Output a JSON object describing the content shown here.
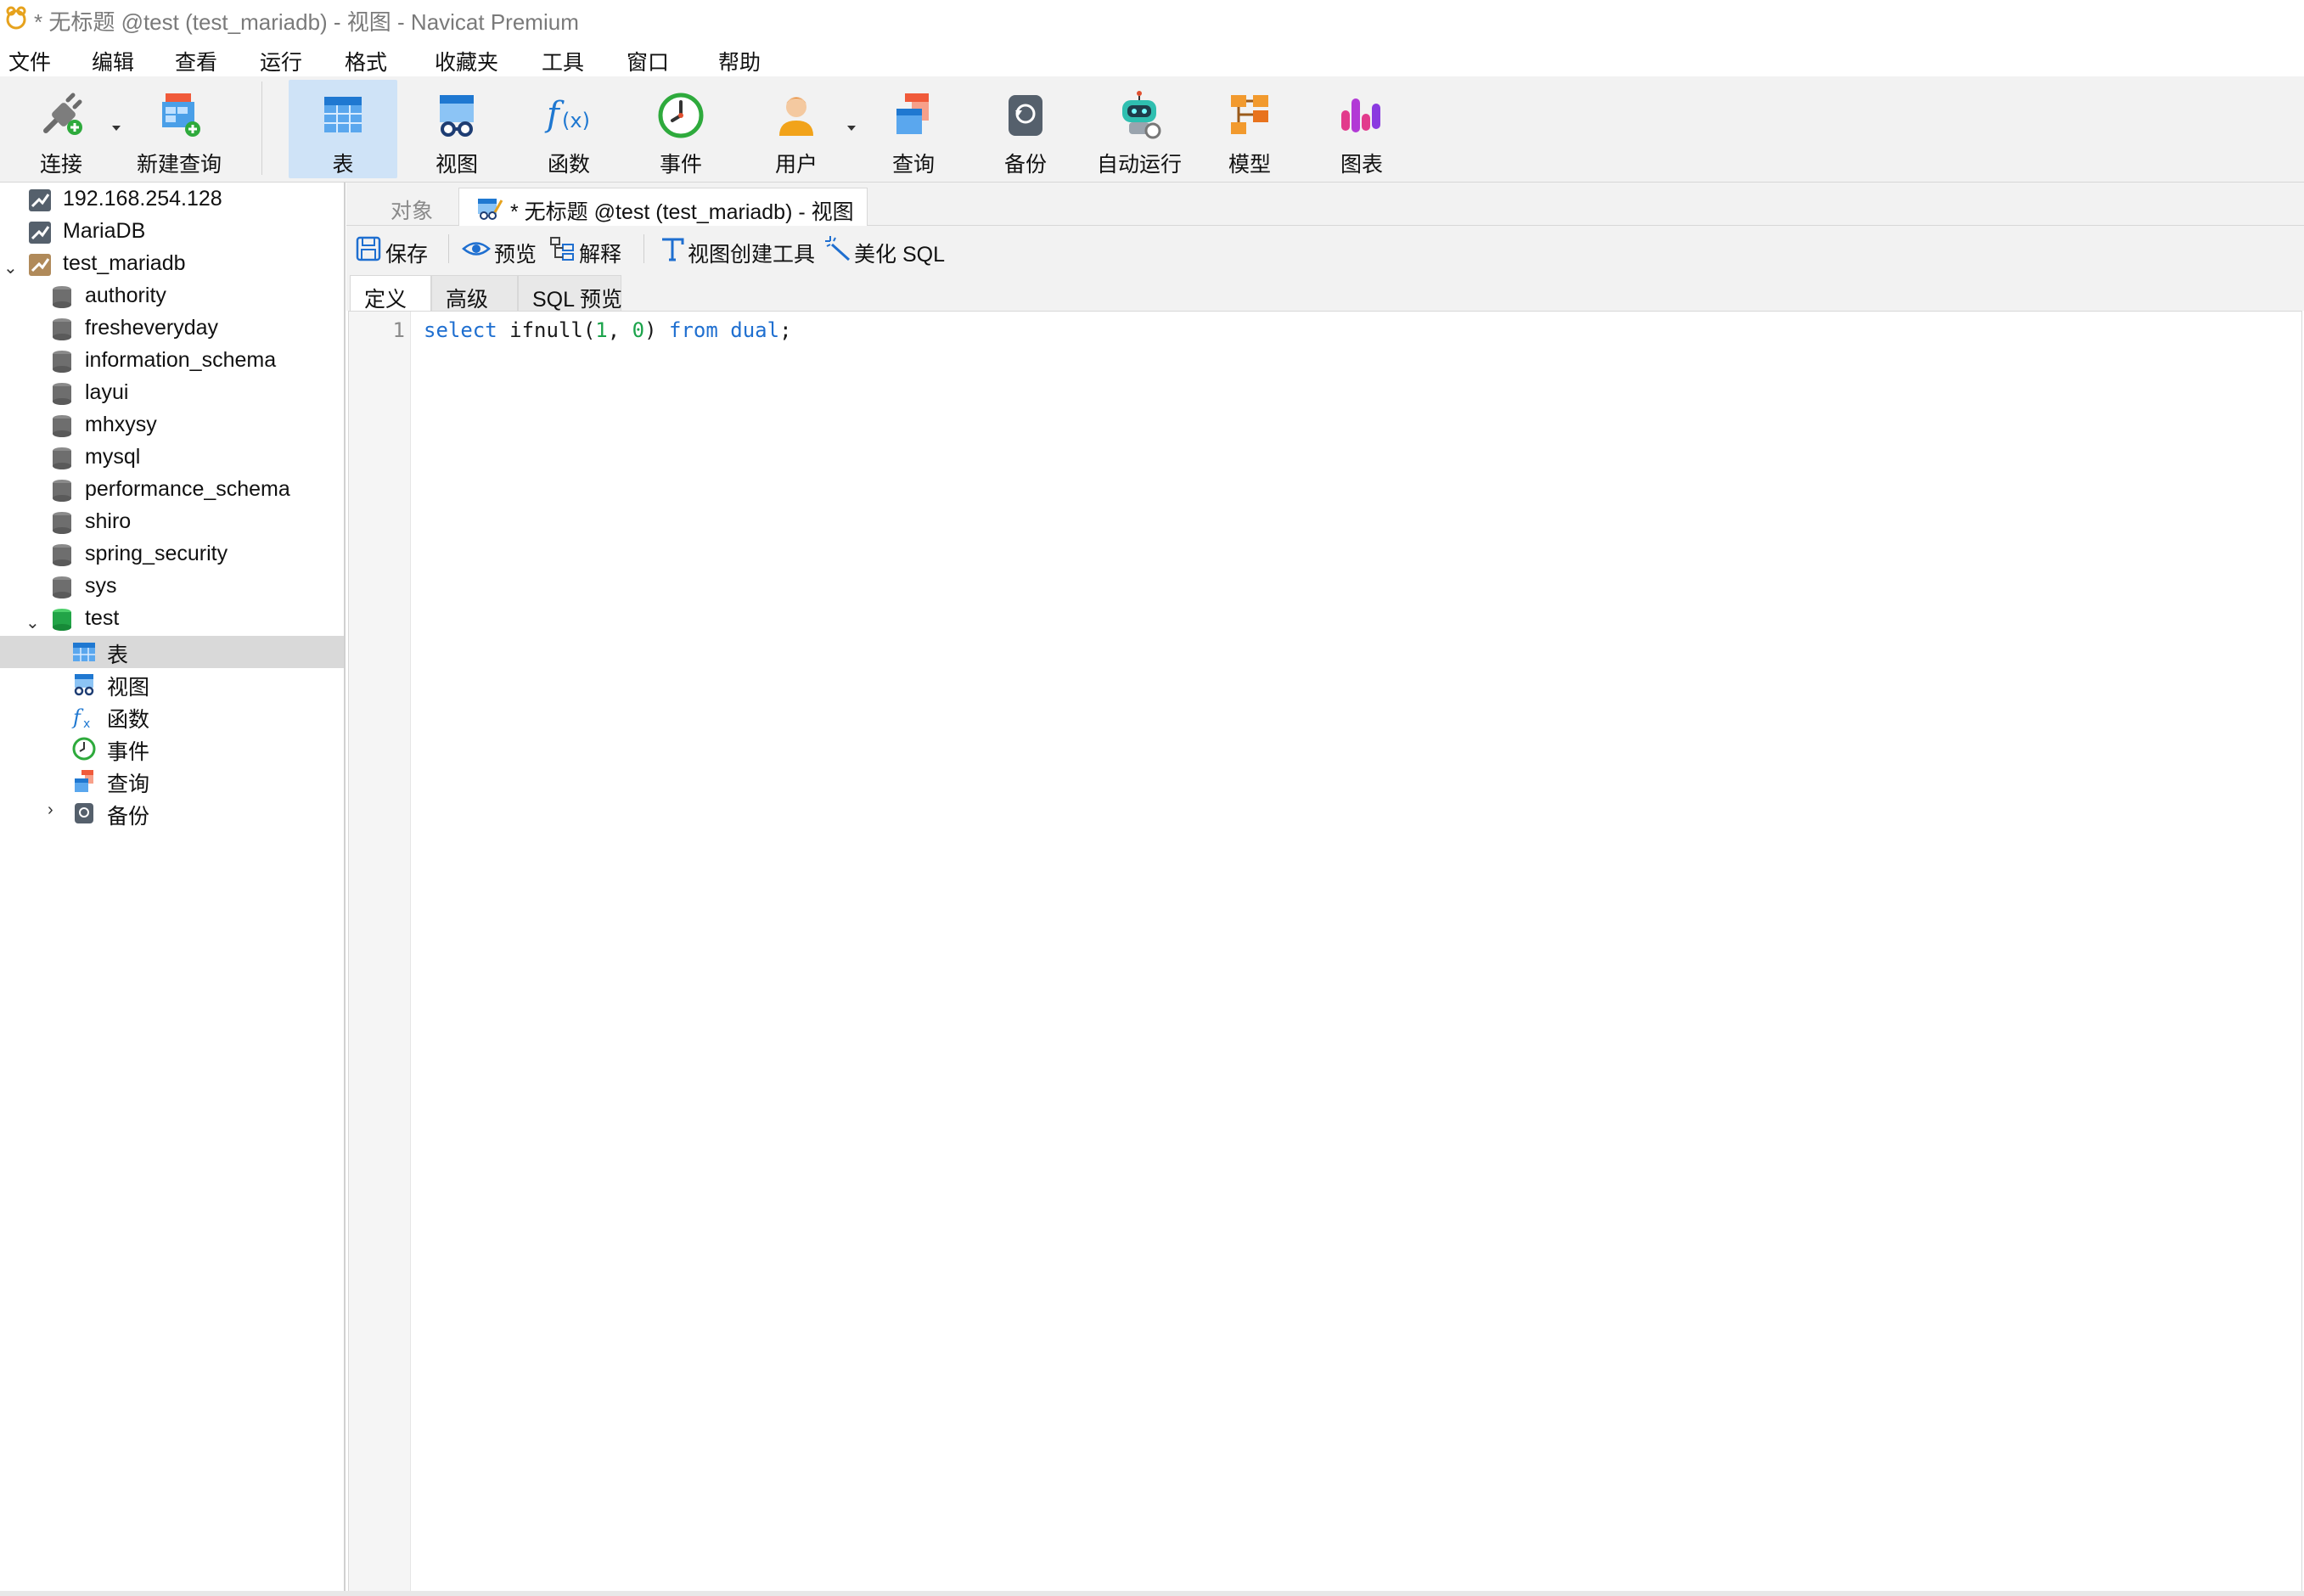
{
  "window": {
    "title": "* 无标题 @test (test_mariadb) - 视图 - Navicat Premium"
  },
  "menu": [
    "文件",
    "编辑",
    "查看",
    "运行",
    "格式",
    "收藏夹",
    "工具",
    "窗口",
    "帮助"
  ],
  "toolbar": {
    "connect": "连接",
    "new_query": "新建查询",
    "table": "表",
    "view": "视图",
    "function": "函数",
    "event": "事件",
    "user": "用户",
    "query": "查询",
    "backup": "备份",
    "automation": "自动运行",
    "model": "模型",
    "chart": "图表",
    "active": "表"
  },
  "sidebar": {
    "connections": [
      "192.168.254.128",
      "MariaDB",
      "test_mariadb"
    ],
    "databases": [
      "authority",
      "fresheveryday",
      "information_schema",
      "layui",
      "mhxysy",
      "mysql",
      "performance_schema",
      "shiro",
      "spring_security",
      "sys",
      "test"
    ],
    "test_children": [
      "表",
      "视图",
      "函数",
      "事件",
      "查询",
      "备份"
    ],
    "selected": "表"
  },
  "tabs": {
    "objects": "对象",
    "document": "* 无标题 @test (test_mariadb) - 视图"
  },
  "actions": {
    "save": "保存",
    "preview": "预览",
    "explain": "解释",
    "view_builder": "视图创建工具",
    "beautify": "美化 SQL"
  },
  "subtabs": {
    "definition": "定义",
    "advanced": "高级",
    "sql_preview": "SQL 预览",
    "active": "定义"
  },
  "editor": {
    "line_number": "1",
    "tokens": {
      "kw_select": "select",
      "fn": " ifnull(",
      "n1": "1",
      "comma": ", ",
      "n0": "0",
      "close": ") ",
      "kw_from": "from",
      "space": " ",
      "kw_dual": "dual",
      "semi": ";"
    }
  },
  "colors": {
    "toolbar_bg": "#f2f2f2",
    "active_button": "#cfe3f7",
    "selected_row": "#d9d9d9",
    "keyword": "#1f6fd0",
    "number": "#1aa34a"
  }
}
